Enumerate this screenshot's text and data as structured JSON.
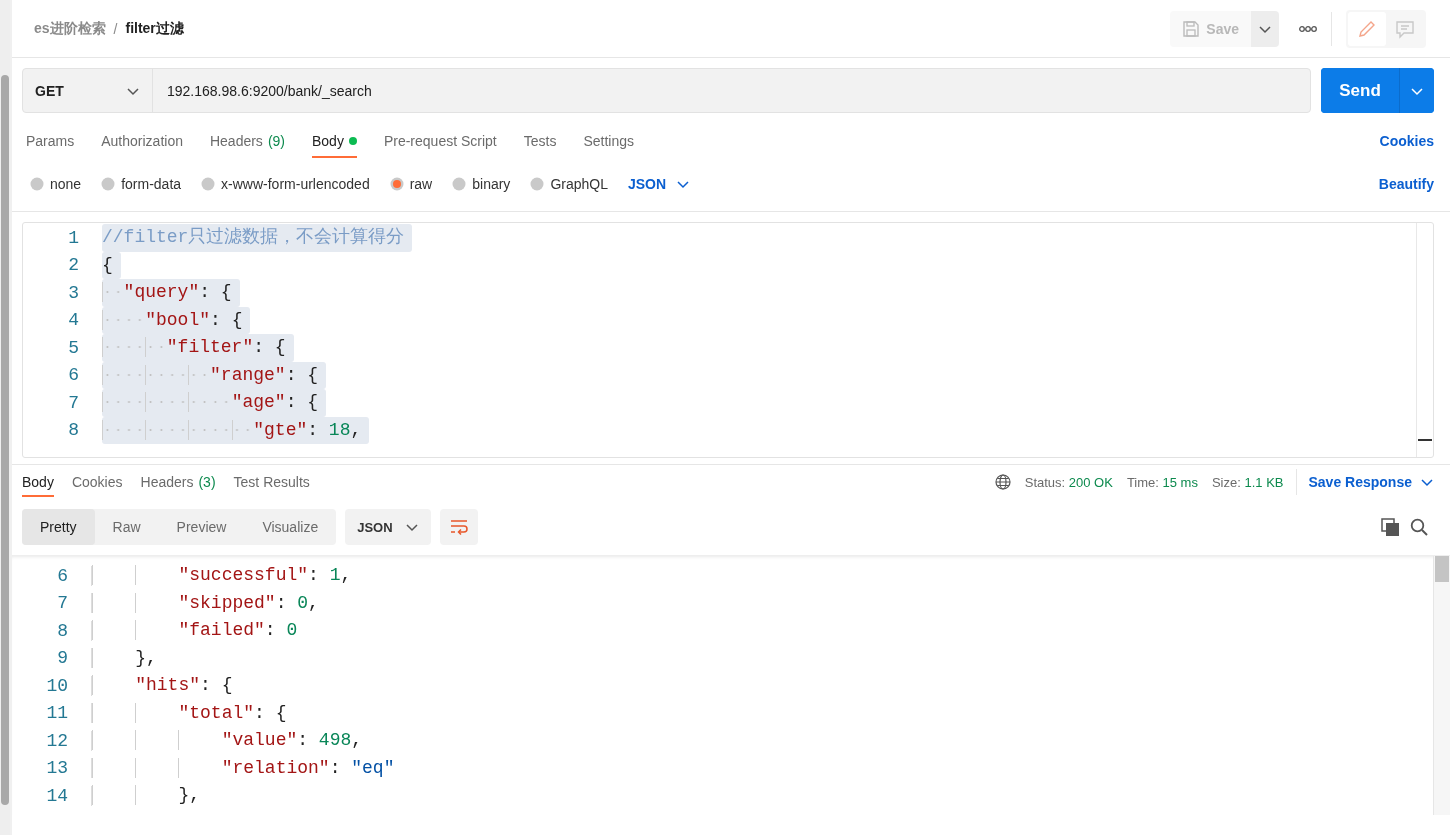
{
  "breadcrumb": {
    "collection": "es进阶检索",
    "separator": "/",
    "request": "filter过滤"
  },
  "header": {
    "save": "Save",
    "save_disabled": true,
    "modes": [
      {
        "kind": "edit",
        "selected": true
      },
      {
        "kind": "comments",
        "selected": false
      }
    ]
  },
  "request": {
    "method": "GET",
    "url": "192.168.98.6:9200/bank/_search",
    "send": "Send"
  },
  "request_tabs": [
    {
      "label": "Params",
      "selected": false,
      "indicator": false
    },
    {
      "label": "Authorization",
      "selected": false,
      "indicator": false
    },
    {
      "label": "Headers",
      "count": "(9)",
      "selected": false,
      "indicator": false
    },
    {
      "label": "Body",
      "selected": true,
      "indicator": true
    },
    {
      "label": "Pre-request Script",
      "selected": false,
      "indicator": false
    },
    {
      "label": "Tests",
      "selected": false,
      "indicator": false
    },
    {
      "label": "Settings",
      "selected": false,
      "indicator": false
    }
  ],
  "cookies_link": "Cookies",
  "body_types": [
    {
      "label": "none",
      "selected": false
    },
    {
      "label": "form-data",
      "selected": false
    },
    {
      "label": "x-www-form-urlencoded",
      "selected": false
    },
    {
      "label": "raw",
      "selected": true
    },
    {
      "label": "binary",
      "selected": false
    },
    {
      "label": "GraphQL",
      "selected": false
    }
  ],
  "body_format": "JSON",
  "beautify": "Beautify",
  "editor": {
    "lines": [
      {
        "number": "1",
        "selected": true,
        "tokens": [
          {
            "kind": "comment",
            "text": "//filter只过滤数据，不会计算得分"
          }
        ]
      },
      {
        "number": "2",
        "selected": true,
        "tokens": [
          {
            "kind": "punct",
            "text": "{"
          }
        ]
      },
      {
        "number": "3",
        "selected": true,
        "tokens": [
          {
            "kind": "key",
            "text": "  \"query\""
          },
          {
            "kind": "punct",
            "text": ": {"
          }
        ]
      },
      {
        "number": "4",
        "selected": true,
        "tokens": [
          {
            "kind": "key",
            "text": "    \"bool\""
          },
          {
            "kind": "punct",
            "text": ": {"
          }
        ]
      },
      {
        "number": "5",
        "selected": true,
        "tokens": [
          {
            "kind": "key",
            "text": "      \"filter\""
          },
          {
            "kind": "punct",
            "text": ": {"
          }
        ]
      },
      {
        "number": "6",
        "selected": true,
        "tokens": [
          {
            "kind": "key",
            "text": "          \"range\""
          },
          {
            "kind": "punct",
            "text": ": {"
          }
        ]
      },
      {
        "number": "7",
        "selected": true,
        "tokens": [
          {
            "kind": "key",
            "text": "            \"age\""
          },
          {
            "kind": "punct",
            "text": ": {"
          }
        ]
      },
      {
        "number": "8",
        "selected": true,
        "tokens": [
          {
            "kind": "key",
            "text": "              \"gte\""
          },
          {
            "kind": "punct",
            "text": ": "
          },
          {
            "kind": "number",
            "text": "18"
          },
          {
            "kind": "punct",
            "text": ","
          }
        ]
      }
    ]
  },
  "response": {
    "tabs": [
      {
        "label": "Body",
        "selected": true
      },
      {
        "label": "Cookies",
        "selected": false
      },
      {
        "label": "Headers",
        "count": "(3)",
        "selected": false
      },
      {
        "label": "Test Results",
        "selected": false
      }
    ],
    "status_label": "Status:",
    "status": "200 OK",
    "time_label": "Time:",
    "time": "15 ms",
    "size_label": "Size:",
    "size": "1.1 KB",
    "save_response": "Save Response",
    "views": [
      {
        "label": "Pretty",
        "selected": true
      },
      {
        "label": "Raw",
        "selected": false
      },
      {
        "label": "Preview",
        "selected": false
      },
      {
        "label": "Visualize",
        "selected": false
      }
    ],
    "format": "JSON",
    "wrap": true,
    "lines": [
      {
        "number": "6",
        "tokens": [
          {
            "kind": "key",
            "text": "        \"successful\""
          },
          {
            "kind": "punct",
            "text": ": "
          },
          {
            "kind": "number",
            "text": "1"
          },
          {
            "kind": "punct",
            "text": ","
          }
        ]
      },
      {
        "number": "7",
        "tokens": [
          {
            "kind": "key",
            "text": "        \"skipped\""
          },
          {
            "kind": "punct",
            "text": ": "
          },
          {
            "kind": "number",
            "text": "0"
          },
          {
            "kind": "punct",
            "text": ","
          }
        ]
      },
      {
        "number": "8",
        "tokens": [
          {
            "kind": "key",
            "text": "        \"failed\""
          },
          {
            "kind": "punct",
            "text": ": "
          },
          {
            "kind": "number",
            "text": "0"
          }
        ]
      },
      {
        "number": "9",
        "tokens": [
          {
            "kind": "punct",
            "text": "    },"
          }
        ]
      },
      {
        "number": "10",
        "tokens": [
          {
            "kind": "key",
            "text": "    \"hits\""
          },
          {
            "kind": "punct",
            "text": ": {"
          }
        ]
      },
      {
        "number": "11",
        "tokens": [
          {
            "kind": "key",
            "text": "        \"total\""
          },
          {
            "kind": "punct",
            "text": ": {"
          }
        ]
      },
      {
        "number": "12",
        "tokens": [
          {
            "kind": "key",
            "text": "            \"value\""
          },
          {
            "kind": "punct",
            "text": ": "
          },
          {
            "kind": "number",
            "text": "498"
          },
          {
            "kind": "punct",
            "text": ","
          }
        ]
      },
      {
        "number": "13",
        "tokens": [
          {
            "kind": "key",
            "text": "            \"relation\""
          },
          {
            "kind": "punct",
            "text": ": "
          },
          {
            "kind": "string",
            "text": "\"eq\""
          }
        ]
      },
      {
        "number": "14",
        "tokens": [
          {
            "kind": "punct",
            "text": "        },"
          }
        ]
      }
    ]
  }
}
